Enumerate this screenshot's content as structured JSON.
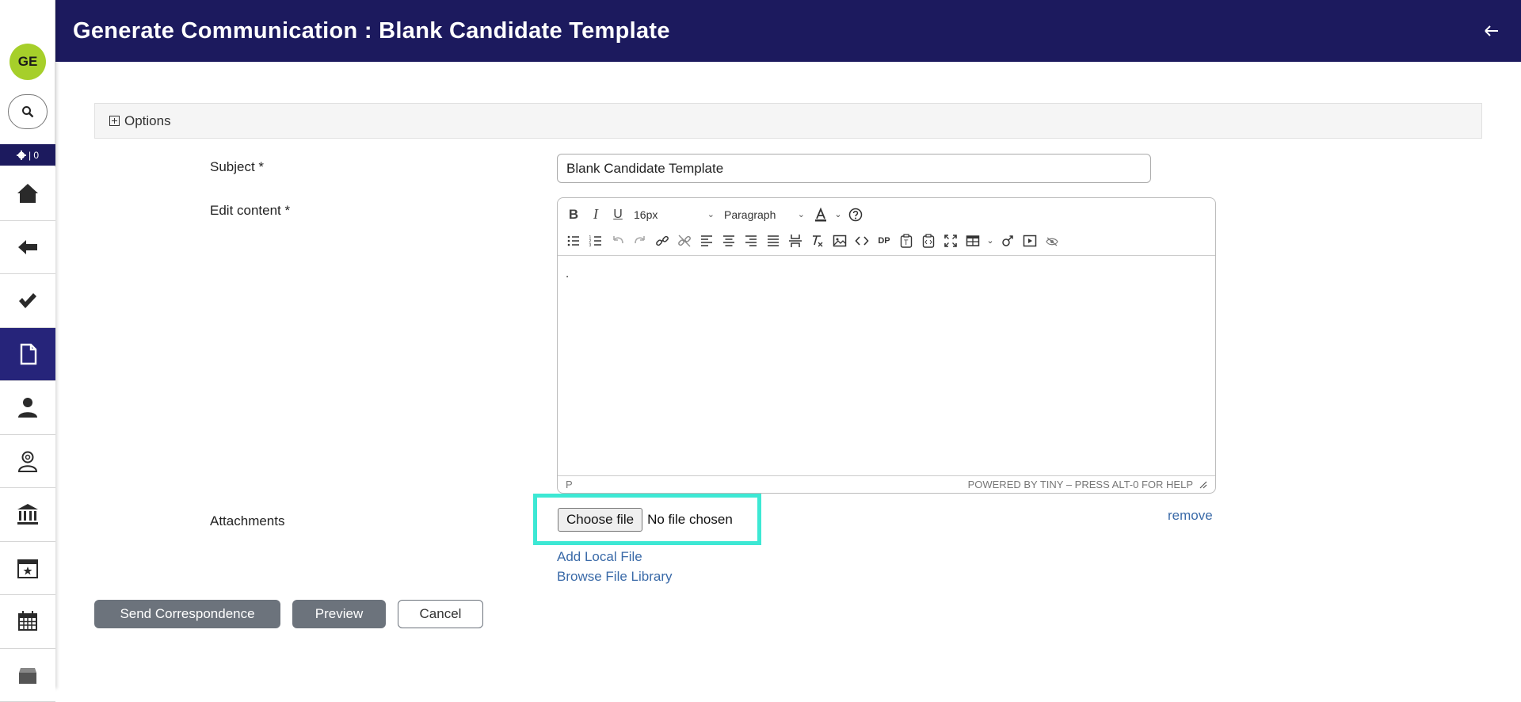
{
  "sidebar": {
    "avatar_initials": "GE",
    "status_count": "| 0",
    "items": [
      {
        "icon": "home-icon"
      },
      {
        "icon": "back-arrow-icon"
      },
      {
        "icon": "checkmark-icon"
      },
      {
        "icon": "document-icon",
        "active": true
      },
      {
        "icon": "person-icon"
      },
      {
        "icon": "person-search-icon"
      },
      {
        "icon": "bank-icon"
      },
      {
        "icon": "calendar-star-icon"
      },
      {
        "icon": "calendar-grid-icon"
      },
      {
        "icon": "archive-box-icon"
      }
    ]
  },
  "header": {
    "title": "Generate Communication : Blank Candidate Template"
  },
  "options": {
    "label": "Options"
  },
  "form": {
    "subject_label": "Subject *",
    "subject_value": "Blank Candidate Template",
    "content_label": "Edit content *",
    "attachments_label": "Attachments"
  },
  "editor": {
    "font_size": "16px",
    "block_format": "Paragraph",
    "content": ".",
    "status_path": "P",
    "status_branding": "POWERED BY TINY – PRESS ALT-0 FOR HELP"
  },
  "attachments": {
    "choose_file_label": "Choose file",
    "no_file_text": "No file chosen",
    "remove_label": "remove",
    "add_local_label": "Add Local File",
    "browse_library_label": "Browse File Library"
  },
  "actions": {
    "send_label": "Send Correspondence",
    "preview_label": "Preview",
    "cancel_label": "Cancel"
  },
  "colors": {
    "header_bg": "#1c1a5e",
    "avatar_bg": "#a6cf2a",
    "highlight": "#3de8d4",
    "link": "#3a6aa8"
  }
}
